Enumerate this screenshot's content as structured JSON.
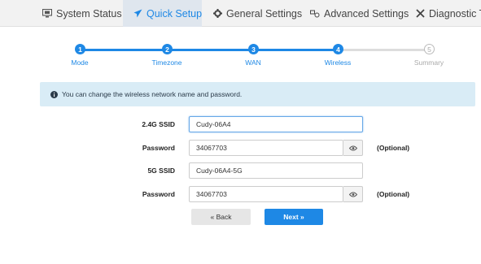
{
  "nav": {
    "tabs": [
      {
        "label": "System Status",
        "icon": "monitor-icon",
        "active": false
      },
      {
        "label": "Quick Setup",
        "icon": "send-icon",
        "active": true
      },
      {
        "label": "General Settings",
        "icon": "gear-icon",
        "active": false
      },
      {
        "label": "Advanced Settings",
        "icon": "advanced-settings-icon",
        "active": false
      },
      {
        "label": "Diagnostic Too",
        "icon": "tools-icon",
        "active": false
      }
    ]
  },
  "stepper": {
    "steps": [
      {
        "number": "1",
        "label": "Mode",
        "state": "done"
      },
      {
        "number": "2",
        "label": "Timezone",
        "state": "done"
      },
      {
        "number": "3",
        "label": "WAN",
        "state": "done"
      },
      {
        "number": "4",
        "label": "Wireless",
        "state": "done"
      },
      {
        "number": "5",
        "label": "Summary",
        "state": "todo"
      }
    ]
  },
  "info": {
    "icon": "info-icon",
    "text": "You can change the wireless network name and password."
  },
  "form": {
    "ssid_24_label": "2.4G SSID",
    "ssid_24_value": "Cudy-06A4",
    "password_24_label": "Password",
    "password_24_value": "34067703",
    "ssid_5_label": "5G SSID",
    "ssid_5_value": "Cudy-06A4-5G",
    "password_5_label": "Password",
    "password_5_value": "34067703",
    "optional_label": "(Optional)"
  },
  "buttons": {
    "back": "« Back",
    "next": "Next »"
  },
  "colors": {
    "accent": "#1e88e5",
    "info_bg": "#d9ecf6",
    "nav_bg": "#f2f2f2",
    "inactive_step": "#dddddd"
  }
}
